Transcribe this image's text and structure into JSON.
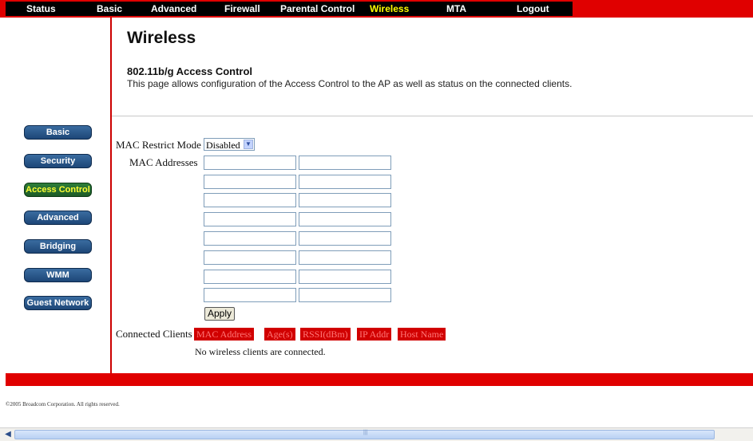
{
  "topnav": {
    "items": [
      {
        "label": "Status"
      },
      {
        "label": "Basic"
      },
      {
        "label": "Advanced"
      },
      {
        "label": "Firewall"
      },
      {
        "label": "Parental Control"
      },
      {
        "label": "Wireless"
      },
      {
        "label": "MTA"
      },
      {
        "label": "Logout"
      }
    ],
    "active": "Wireless"
  },
  "header": {
    "title": "Wireless",
    "section_title": "802.11b/g Access Control",
    "section_desc": "This page allows configuration of the Access Control to the AP as well as status on the connected clients."
  },
  "sidebar": {
    "items": [
      {
        "label": "Basic"
      },
      {
        "label": "Security"
      },
      {
        "label": "Access Control"
      },
      {
        "label": "Advanced"
      },
      {
        "label": "Bridging"
      },
      {
        "label": "WMM"
      },
      {
        "label": "Guest Network"
      }
    ],
    "active": "Access Control"
  },
  "form": {
    "mac_restrict_label": "MAC Restrict Mode",
    "mac_restrict_value": "Disabled",
    "mac_addresses_label": "MAC Addresses",
    "mac_addresses": [
      "",
      "",
      "",
      "",
      "",
      "",
      "",
      "",
      "",
      "",
      "",
      "",
      "",
      "",
      "",
      ""
    ],
    "apply_label": "Apply"
  },
  "clients": {
    "label": "Connected Clients",
    "columns": [
      "MAC Address",
      "Age(s)",
      "RSSI(dBm)",
      "IP Addr",
      "Host Name"
    ],
    "empty_message": "No wireless clients are connected."
  },
  "footer": {
    "copyright": "©2005 Broadcom Corporation. All rights reserved."
  },
  "colors": {
    "nav_bar": "#e00000",
    "active_nav": "#ffff00",
    "sidebar_button": "#1d4677",
    "table_header": "#d10000"
  }
}
